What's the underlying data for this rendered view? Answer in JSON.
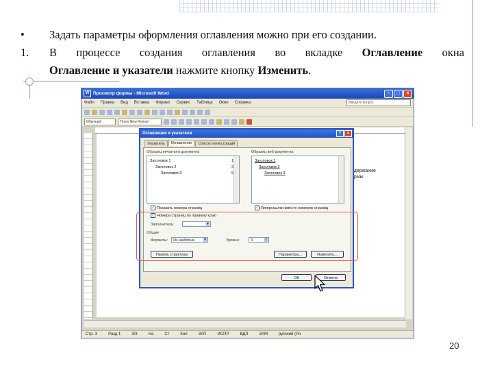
{
  "slide": {
    "bullet_marker": "•",
    "bullet_text": "Задать параметры оформления оглавления можно при его создании.",
    "step_marker": "1.",
    "step_text_1": "В процессе создания оглавления во вкладке",
    "step_bold_1": "Оглавление",
    "step_text_2": "окна",
    "step_bold_2": "Оглавление и указатели",
    "step_text_3": "нажмите кнопку",
    "step_bold_3": "Изменить",
    "step_end": ".",
    "page_number": "20"
  },
  "word": {
    "title": "Просмотр формы - Microsoft Word",
    "menu": [
      "Файл",
      "Правка",
      "Вид",
      "Вставка",
      "Формат",
      "Сервис",
      "Таблица",
      "Окно",
      "Справка"
    ],
    "help_placeholder": "Введите вопрос",
    "style_combo": "Обычный",
    "font_combo": "Times New Roman",
    "side_text_1": "одержание",
    "side_text_2": "ормы",
    "status": [
      "Стр. 3",
      "Разд 1",
      "3/3",
      "На",
      "Ст",
      "Кол",
      "ЗАП",
      "ИСПР",
      "ВДЛ",
      "ЗАМ",
      "русский (Ро"
    ]
  },
  "dialog": {
    "title": "Оглавление и указатели",
    "help_glyph": "?",
    "close_glyph": "×",
    "tabs": [
      "Указатель",
      "Оглавление",
      "Список иллюстраций"
    ],
    "print_preview_label": "Образец печатного документа",
    "web_preview_label": "Образец веб-документа",
    "print_lines": [
      {
        "text": "Заголовок 1",
        "page": "1"
      },
      {
        "text": "Заголовок 2",
        "page": "3"
      },
      {
        "text": "Заголовок 3",
        "page": "5"
      }
    ],
    "web_lines": [
      "Заголовок 1",
      "Заголовок 2",
      "Заголовок 3"
    ],
    "check_page_numbers": "Показать номера страниц",
    "check_right_align": "Номера страниц по правому краю",
    "check_hyperlinks": "Гиперссылки вместо номеров страниц",
    "leader_label": "Заполнитель:",
    "leader_value": ".......",
    "general_label": "Общие",
    "formats_label": "Форматы:",
    "formats_value": "Из шаблона",
    "levels_label": "Уровни:",
    "levels_value": "3",
    "btn_outline": "Панель структуры",
    "btn_options": "Параметры...",
    "btn_modify": "Изменить...",
    "btn_ok": "ОК",
    "btn_cancel": "Отмена"
  }
}
